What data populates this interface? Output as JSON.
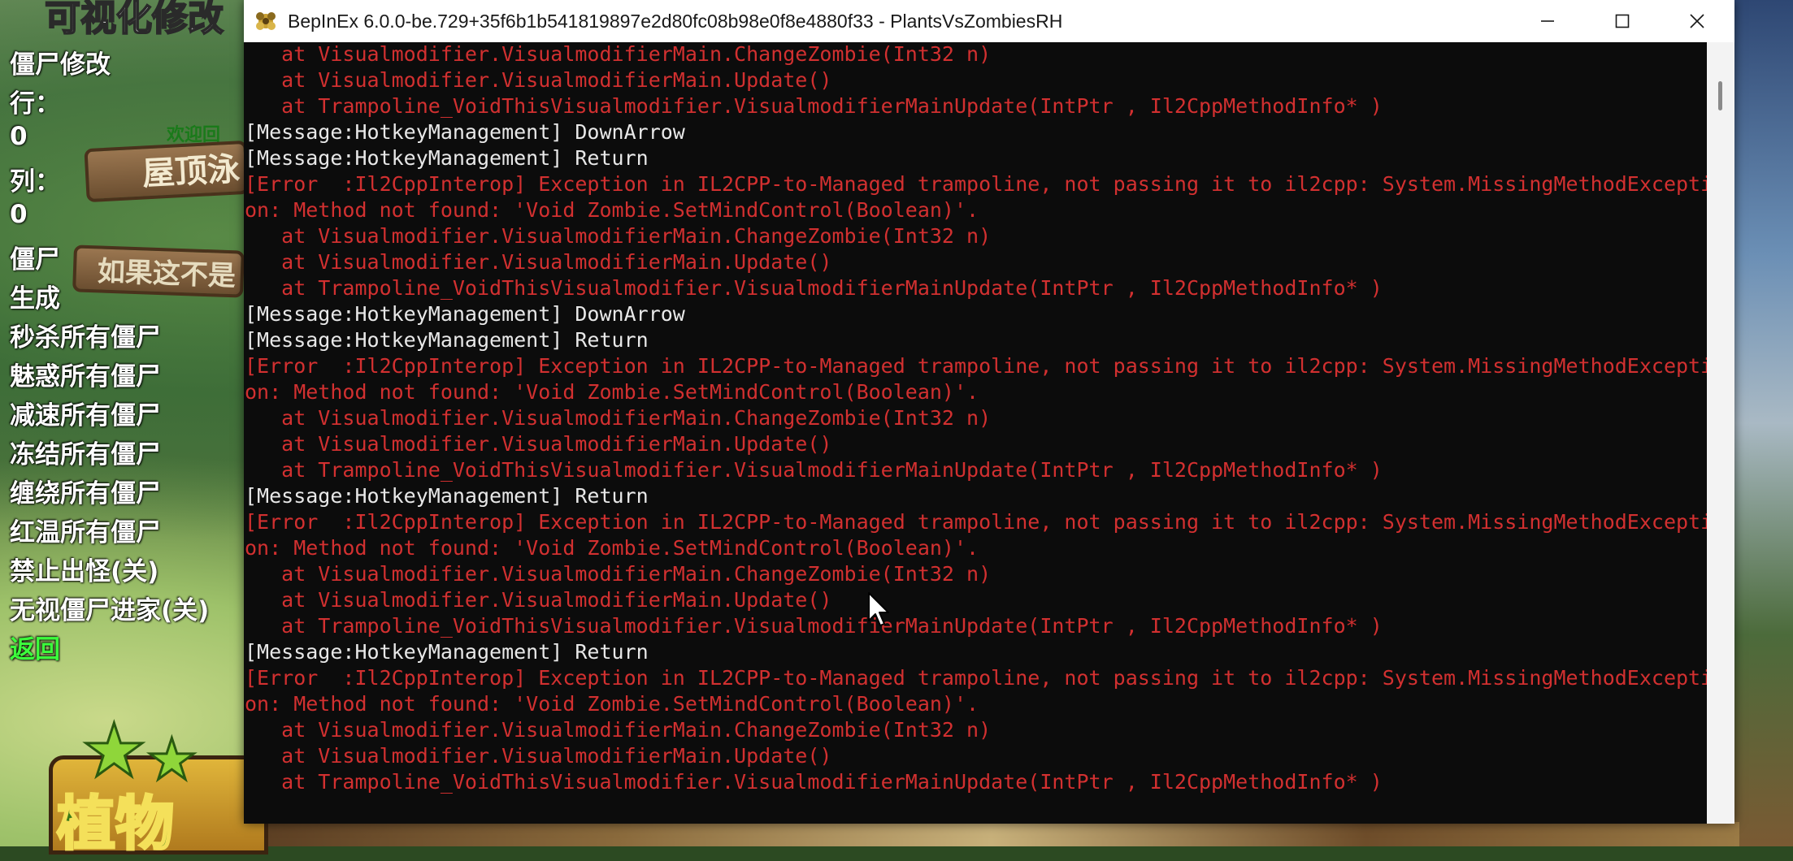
{
  "game": {
    "title": "可视化修改",
    "roof_sign": "屋顶泳",
    "welcome": "欢迎回",
    "skip_sign": "如果这不是",
    "logo_text": "植物"
  },
  "mod_menu": {
    "items": [
      {
        "label": "僵尸修改"
      },
      {
        "label": "行："
      },
      {
        "label": "0"
      },
      {
        "label": "列："
      },
      {
        "label": "0"
      },
      {
        "label": "僵尸"
      },
      {
        "label": "生成"
      },
      {
        "label": "秒杀所有僵尸"
      },
      {
        "label": "魅惑所有僵尸"
      },
      {
        "label": "减速所有僵尸"
      },
      {
        "label": "冻结所有僵尸"
      },
      {
        "label": "缠绕所有僵尸"
      },
      {
        "label": "红温所有僵尸"
      },
      {
        "label": "禁止出怪(关)"
      },
      {
        "label": "无视僵尸进家(关)"
      },
      {
        "label": "返回"
      }
    ]
  },
  "console": {
    "title": "BepInEx 6.0.0-be.729+35f6b1b541819897e2d80fc08b98e0f8e4880f33 - PlantsVsZombiesRH",
    "icon": "bepinex-icon",
    "colors": {
      "error": "#d23030",
      "message": "#e8e8e8",
      "background": "#0c0c0c"
    },
    "lines": [
      {
        "type": "err",
        "text": "   at Visualmodifier.VisualmodifierMain.ChangeZombie(Int32 n)"
      },
      {
        "type": "err",
        "text": "   at Visualmodifier.VisualmodifierMain.Update()"
      },
      {
        "type": "err",
        "text": "   at Trampoline_VoidThisVisualmodifier.VisualmodifierMainUpdate(IntPtr , Il2CppMethodInfo* )"
      },
      {
        "type": "msg",
        "text": "[Message:HotkeyManagement] DownArrow"
      },
      {
        "type": "msg",
        "text": "[Message:HotkeyManagement] Return"
      },
      {
        "type": "err",
        "text": "[Error  :Il2CppInterop] Exception in IL2CPP-to-Managed trampoline, not passing it to il2cpp: System.MissingMethodExcepti"
      },
      {
        "type": "err",
        "text": "on: Method not found: 'Void Zombie.SetMindControl(Boolean)'."
      },
      {
        "type": "err",
        "text": "   at Visualmodifier.VisualmodifierMain.ChangeZombie(Int32 n)"
      },
      {
        "type": "err",
        "text": "   at Visualmodifier.VisualmodifierMain.Update()"
      },
      {
        "type": "err",
        "text": "   at Trampoline_VoidThisVisualmodifier.VisualmodifierMainUpdate(IntPtr , Il2CppMethodInfo* )"
      },
      {
        "type": "msg",
        "text": "[Message:HotkeyManagement] DownArrow"
      },
      {
        "type": "msg",
        "text": "[Message:HotkeyManagement] Return"
      },
      {
        "type": "err",
        "text": "[Error  :Il2CppInterop] Exception in IL2CPP-to-Managed trampoline, not passing it to il2cpp: System.MissingMethodExcepti"
      },
      {
        "type": "err",
        "text": "on: Method not found: 'Void Zombie.SetMindControl(Boolean)'."
      },
      {
        "type": "err",
        "text": "   at Visualmodifier.VisualmodifierMain.ChangeZombie(Int32 n)"
      },
      {
        "type": "err",
        "text": "   at Visualmodifier.VisualmodifierMain.Update()"
      },
      {
        "type": "err",
        "text": "   at Trampoline_VoidThisVisualmodifier.VisualmodifierMainUpdate(IntPtr , Il2CppMethodInfo* )"
      },
      {
        "type": "msg",
        "text": "[Message:HotkeyManagement] Return"
      },
      {
        "type": "err",
        "text": "[Error  :Il2CppInterop] Exception in IL2CPP-to-Managed trampoline, not passing it to il2cpp: System.MissingMethodExcepti"
      },
      {
        "type": "err",
        "text": "on: Method not found: 'Void Zombie.SetMindControl(Boolean)'."
      },
      {
        "type": "err",
        "text": "   at Visualmodifier.VisualmodifierMain.ChangeZombie(Int32 n)"
      },
      {
        "type": "err",
        "text": "   at Visualmodifier.VisualmodifierMain.Update()"
      },
      {
        "type": "err",
        "text": "   at Trampoline_VoidThisVisualmodifier.VisualmodifierMainUpdate(IntPtr , Il2CppMethodInfo* )"
      },
      {
        "type": "msg",
        "text": "[Message:HotkeyManagement] Return"
      },
      {
        "type": "err",
        "text": "[Error  :Il2CppInterop] Exception in IL2CPP-to-Managed trampoline, not passing it to il2cpp: System.MissingMethodExcepti"
      },
      {
        "type": "err",
        "text": "on: Method not found: 'Void Zombie.SetMindControl(Boolean)'."
      },
      {
        "type": "err",
        "text": "   at Visualmodifier.VisualmodifierMain.ChangeZombie(Int32 n)"
      },
      {
        "type": "err",
        "text": "   at Visualmodifier.VisualmodifierMain.Update()"
      },
      {
        "type": "err",
        "text": "   at Trampoline_VoidThisVisualmodifier.VisualmodifierMainUpdate(IntPtr , Il2CppMethodInfo* )"
      }
    ]
  }
}
